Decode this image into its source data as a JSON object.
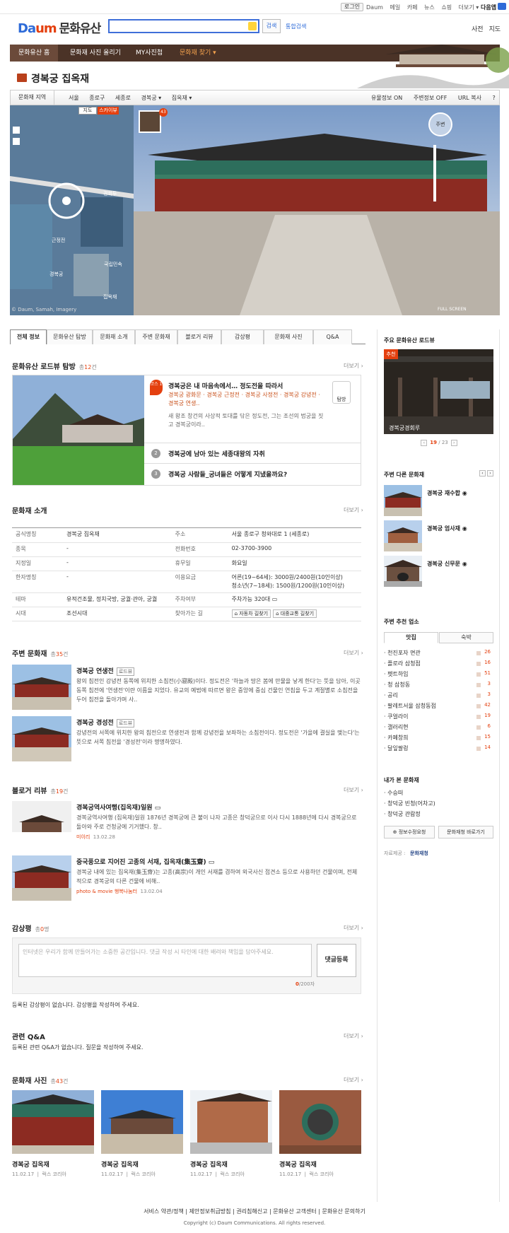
{
  "topbar": {
    "login": "로그인",
    "links": [
      "Daum",
      "메일",
      "카페",
      "뉴스",
      "쇼핑",
      "더보기 ▾"
    ],
    "app": "다음앱"
  },
  "header": {
    "logo_a": "Da",
    "logo_b": "um",
    "site": "문화유산",
    "search_btn": "검색",
    "unified_search": "통합검색",
    "right_links": [
      "사전",
      "지도"
    ]
  },
  "nav": {
    "items": [
      "문화유산 홈",
      "문화재 사진 올리기",
      "MY사진첩",
      "문화재 찾기 ▾"
    ]
  },
  "title": "경복궁 집옥재",
  "crumb": {
    "region": "문화재 지역",
    "paths": [
      "서울",
      "종로구",
      "세종로",
      "경복궁 ▾",
      "집옥재 ▾"
    ],
    "opts": [
      "유물정보 ON",
      "주변정보 OFF",
      "URL 복사",
      "?"
    ]
  },
  "map": {
    "btn_map": "지도",
    "btn_sky": "스카이뷰",
    "labels": [
      "경회루",
      "근정전",
      "경복궁",
      "국립민속",
      "집옥재"
    ],
    "copyright": "© Daum, Samah, Imagery"
  },
  "roadview": {
    "count": "43",
    "compass": "주변",
    "full": "FULL SCREEN"
  },
  "tabs": [
    "전체 정보",
    "문화유산 탐방",
    "문화재 소개",
    "주변 문화재",
    "블로거 리뷰",
    "감상평",
    "문화재 사진",
    "Q&A"
  ],
  "tour": {
    "title": "문화유산 로드뷰 탐방",
    "count_pre": "총",
    "count": "12",
    "count_suf": "건",
    "more": "더보기 ›",
    "badge": "코스 1",
    "item1_title": "경복궁은 내 마음속에서… 정도전을 따라서",
    "item1_links": "경복궁 광화문 · 경복궁 근정전 · 경복궁 사정전 · 경복궁 강녕전 · 경복궁 연생..",
    "item1_desc": "새 왕조 창건의 사상적 토대를 닦은 정도전, 그는 조선의 법궁을 짓고 경복궁이라..",
    "tb": "탐방",
    "item2_num": "2",
    "item2_title": "경복궁에 남아 있는 세종대왕의 자취",
    "item3_num": "3",
    "item3_title": "경복궁 사람들_궁녀들은 어떻게 지냈을까요?"
  },
  "intro": {
    "title": "문화재 소개",
    "more": "더보기 ›",
    "rows": [
      [
        "공식명칭",
        "경복궁 집옥재",
        "주소",
        "서울 종로구 청와대로 1 (세종로)"
      ],
      [
        "종목",
        "-",
        "전화번호",
        "02-3700-3900"
      ],
      [
        "지정일",
        "-",
        "휴무일",
        "화요일"
      ],
      [
        "한자명칭",
        "-",
        "이용요금",
        "어른(19~64세): 3000원/2400원(10인이상)\n청소년(7~18세): 1500원/1200원(10인이상)"
      ],
      [
        "테마",
        "유적건조물, 정치국방, 궁궐·관아, 궁궐",
        "주차여부",
        "주차가능 320대 ▭"
      ],
      [
        "시대",
        "조선시대",
        "찾아가는 길",
        ""
      ]
    ],
    "btn_car": "⌂ 자동차 길찾기",
    "btn_bus": "⌂ 대중교통 길찾기"
  },
  "nearby": {
    "title": "주변 문화재",
    "count_pre": "총",
    "count": "35",
    "count_suf": "건",
    "more": "더보기 ›",
    "items": [
      {
        "title": "경복궁 연생전",
        "tag": "로드뷰",
        "desc": "왕의 침전인 강녕전 동쪽에 위치한 소침전(小寢殿)이다. 정도전은 '하늘과 땅은 봄에 만물을 낳게 한다'는 뜻을 담아, 이곳 동쪽 침전에 '연생전'이란 이름을 지었다. 유교의 예법에 따르면 왕은 중앙에 중심 건물인 연침을 두고 계절별로 소침전을 두어 침전을 돌아가며 사.."
      },
      {
        "title": "경복궁 경성전",
        "tag": "로드뷰",
        "desc": "강녕전의 서쪽에 위치한 왕의 침전으로 연생전과 함께 강녕전을 보좌하는 소침전이다. 정도전은 '가을에 결실을 맺는다'는 뜻으로 서쪽 침전을 '경성전'이라 명명하였다."
      }
    ]
  },
  "blog": {
    "title": "블로거 리뷰",
    "count_pre": "총",
    "count": "19",
    "count_suf": "건",
    "more": "더보기 ›",
    "items": [
      {
        "title": "경복궁역사여행(집옥재)일원 ▭",
        "desc": "경복궁역사여행 (집옥재)일원 1876년 경복궁에 큰 불이 나자 고종은 창덕궁으로 이사 다시 1888년에 다시 경복궁으로 돌아와 주로 건청궁에 기거했다. 창..",
        "author": "미이리",
        "date": "13.02.28"
      },
      {
        "title": "중국풍으로 지어진 고종의 서재, 집옥재(集玉齋) ▭",
        "desc": "경복궁 내에 있는 집옥재(集玉齋)는 고종(高宗)이 개인 서재를 겸하여 외국사신 접견소 등으로 사용하던 건물이며, 전체적으로 경복궁의 다른 건물에 비해..",
        "author": "photo & movie 행복나눔터",
        "date": "13.02.04"
      }
    ]
  },
  "review": {
    "title": "감상평",
    "count_pre": "총",
    "count": "0",
    "count_suf": "명",
    "more": "더보기 ›",
    "placeholder": "인터넷은 우리가 함께 만들어가는 소중한 공간입니다. 댓글 작성 시 타인에 대한 배려와 책임을 담아주세요.",
    "submit": "댓글등록",
    "cnt_now": "0",
    "cnt_max": "/200자",
    "empty": "등록된 감상평이 없습니다. 감상평을 작성하여 주세요."
  },
  "qa": {
    "title": "관련 Q&A",
    "more": "더보기 ›",
    "empty": "등록된 관련 Q&A가 없습니다. 질문을 작성하여 주세요."
  },
  "photos": {
    "title": "문화재 사진",
    "count_pre": "총",
    "count": "43",
    "count_suf": "건",
    "more": "더보기 ›",
    "items": [
      {
        "title": "경복궁 집옥재",
        "date": "11.02.17",
        "author": "럭스 코리아"
      },
      {
        "title": "경복궁 집옥재",
        "date": "11.02.17",
        "author": "럭스 코리아"
      },
      {
        "title": "경복궁 집옥재",
        "date": "11.02.17",
        "author": "럭스 코리아"
      },
      {
        "title": "경복궁 집옥재",
        "date": "11.02.17",
        "author": "럭스 코리아"
      }
    ]
  },
  "right": {
    "rv_title": "주요 문화유산 로드뷰",
    "rv_badge": "추천",
    "rv_caption": "경복궁경회루",
    "rv_cur": "19",
    "rv_total": " / 23",
    "other_title": "주변 다른 문화재",
    "others": [
      "경복궁 재수합 ◉",
      "경복궁 엄사재 ◉",
      "경복궁 신무문 ◉"
    ],
    "biz_title": "주변 추천 업소",
    "biz_tabs": [
      "맛집",
      "숙박"
    ],
    "biz": [
      [
        "천진포자 면관",
        "26"
      ],
      [
        "플로라 삼청점",
        "16"
      ],
      [
        "펫트하임",
        "51"
      ],
      [
        "청 삼청동",
        "3"
      ],
      [
        "공리",
        "3"
      ],
      [
        "팔레트서울 삼청동점",
        "42"
      ],
      [
        "쿠얼라이",
        "19"
      ],
      [
        "갤러리현",
        "6"
      ],
      [
        "카페창희",
        "15"
      ],
      [
        "달잎팔렁",
        "14"
      ]
    ],
    "seen_title": "내가 본 문화재",
    "seen": [
      "수승떠",
      "창덕궁 빈청(어차고)",
      "창덕궁 관람정"
    ],
    "btn_edit": "⊕ 정보수정요청",
    "btn_go": "문화재청 바로가기",
    "source_label": "자료제공 :",
    "source": "문화재청"
  },
  "footer": {
    "links": "서비스 약관/정책  |  제안정보취급방침  |  권리침해신고  |  문화유산 고객센터  |  문화유산 문의하기",
    "copy": "Copyright (c) Daum Communications. All rights reserved."
  }
}
